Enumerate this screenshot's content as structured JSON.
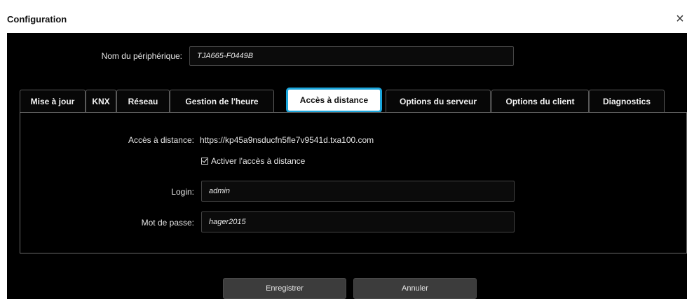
{
  "window": {
    "title": "Configuration",
    "close_glyph": "×",
    "close_icon": "close-icon"
  },
  "device": {
    "name_label": "Nom du périphérique:",
    "name_value": "TJA665-F0449B"
  },
  "tabs": [
    {
      "label": "Mise à jour",
      "active": false
    },
    {
      "label": "KNX",
      "active": false
    },
    {
      "label": "Réseau",
      "active": false
    },
    {
      "label": "Gestion de l'heure",
      "active": false
    },
    {
      "label": "Accès à distance",
      "active": true
    },
    {
      "label": "Options du serveur",
      "active": false
    },
    {
      "label": "Options du client",
      "active": false
    },
    {
      "label": "Diagnostics",
      "active": false
    }
  ],
  "remote": {
    "access_label": "Accès à distance:",
    "access_url": "https://kp45a9nsducfn5fle7v9541d.txa100.com",
    "enable_label": "Activer l'accès à distance",
    "enable_checked": true,
    "login_label": "Login:",
    "login_value": "admin",
    "password_label": "Mot de passe:",
    "password_value": "hager2015"
  },
  "buttons": {
    "save_label": "Enregistrer",
    "cancel_label": "Annuler"
  },
  "colors": {
    "accent": "#1ba6dc",
    "background": "#000000",
    "button": "#3c3c3c"
  }
}
